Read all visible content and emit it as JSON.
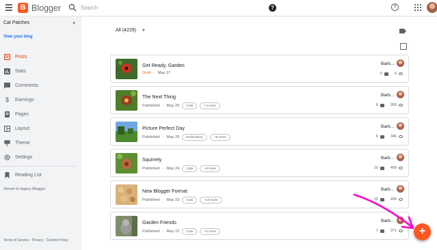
{
  "app": {
    "title": "Blogger"
  },
  "search": {
    "placeholder": "Search"
  },
  "blog": {
    "name": "Cat Patches",
    "view_link": "View your blog"
  },
  "sidebar": {
    "items": [
      {
        "label": "Posts",
        "icon": "posts-icon",
        "active": true
      },
      {
        "label": "Stats",
        "icon": "stats-icon"
      },
      {
        "label": "Comments",
        "icon": "comments-icon"
      },
      {
        "label": "Earnings",
        "icon": "dollar-icon"
      },
      {
        "label": "Pages",
        "icon": "pages-icon"
      },
      {
        "label": "Layout",
        "icon": "layout-icon"
      },
      {
        "label": "Theme",
        "icon": "theme-icon"
      },
      {
        "label": "Settings",
        "icon": "gear-icon"
      }
    ],
    "reading_list": "Reading List",
    "legacy": "Revert to legacy Blogger",
    "footer": "Terms of Service · Privacy · Content Policy"
  },
  "main": {
    "filter_label": "All (4229)",
    "posts": [
      {
        "title": "Get Ready, Garden",
        "status": "Draft",
        "date": "May 27",
        "chips": [],
        "author": "Barb...",
        "comments": "0",
        "views": "0"
      },
      {
        "title": "The Next Thing",
        "status": "Published",
        "date": "May 26",
        "chips": [
          "Cats",
          "+4 more"
        ],
        "author": "Barb...",
        "comments": "8",
        "views": "269"
      },
      {
        "title": "Picture Perfect Day",
        "status": "Published",
        "date": "May 25",
        "chips": [
          "Embroidery",
          "+6 more"
        ],
        "author": "Barb...",
        "comments": "6",
        "views": "346"
      },
      {
        "title": "Squirrely",
        "status": "Published",
        "date": "May 24",
        "chips": [
          "Cats",
          "+8 more"
        ],
        "author": "Barb...",
        "comments": "10",
        "views": "458"
      },
      {
        "title": "New Blogger Format",
        "status": "Published",
        "date": "May 23",
        "chips": [
          "Cats",
          "+10 more"
        ],
        "author": "Barb...",
        "comments": "15",
        "views": "490"
      },
      {
        "title": "Garden Friends",
        "status": "Published",
        "date": "May 22",
        "chips": [
          "Cats",
          "+5 more"
        ],
        "author": "Barb...",
        "comments": "7",
        "views": "371"
      }
    ]
  },
  "fab": {
    "label": "+"
  },
  "colors": {
    "accent": "#ff5722",
    "draft": "#e8710a",
    "link": "#1a73e8",
    "annotation_arrow": "#ff00cc"
  }
}
